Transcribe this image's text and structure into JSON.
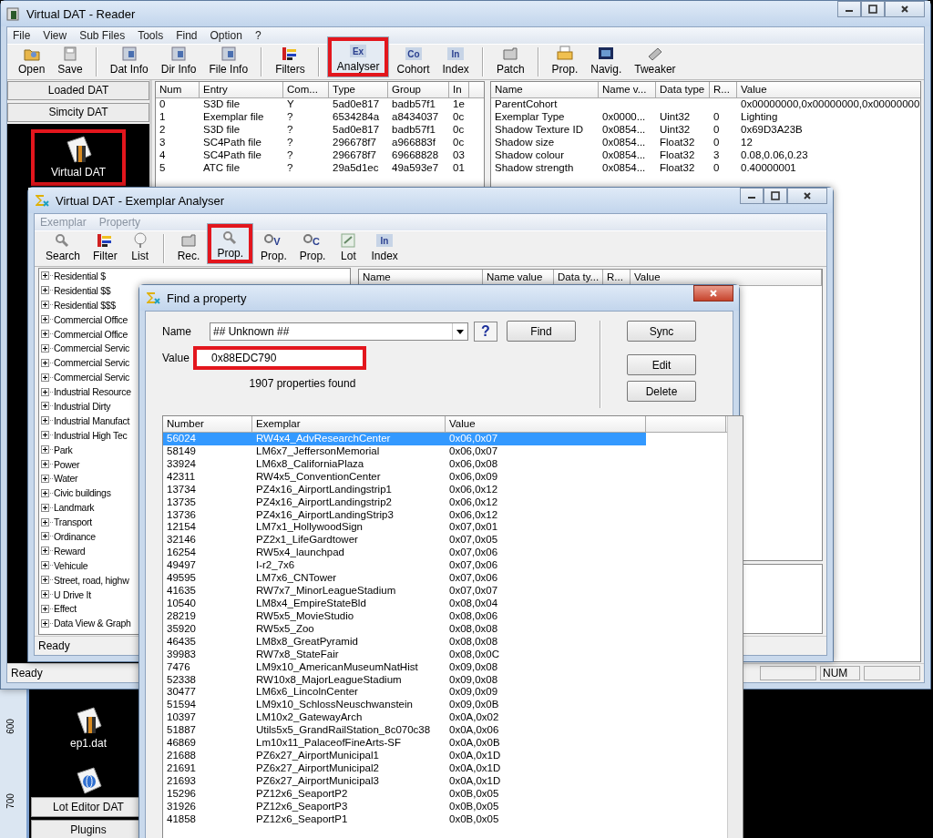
{
  "desktop": {
    "ruler_labels": [
      "600",
      "700"
    ],
    "icons": [
      {
        "label": "ep1.dat",
        "kind": "file"
      },
      {
        "kind": "globe"
      }
    ],
    "bars": [
      "Lot Editor DAT",
      "Plugins"
    ]
  },
  "main_window": {
    "title": "Virtual DAT - Reader",
    "menu": [
      "File",
      "View",
      "Sub Files",
      "Tools",
      "Find",
      "Option",
      "?"
    ],
    "toolbar": [
      {
        "kind": "folder",
        "label": "Open",
        "pressed": false,
        "highlighted": false
      },
      {
        "kind": "disk",
        "label": "Save",
        "pressed": false,
        "highlighted": false
      },
      {
        "kind": "separator"
      },
      {
        "kind": "info",
        "label": "Dat Info",
        "pressed": false,
        "highlighted": false
      },
      {
        "kind": "info",
        "label": "Dir Info",
        "pressed": false,
        "highlighted": false
      },
      {
        "kind": "info",
        "label": "File Info",
        "pressed": false,
        "highlighted": false
      },
      {
        "kind": "separator"
      },
      {
        "kind": "filter",
        "label": "Filters",
        "pressed": false,
        "highlighted": false
      },
      {
        "kind": "separator"
      },
      {
        "kind": "letters",
        "icon_text": "Ex",
        "label": "Analyser",
        "pressed": true,
        "highlighted": true
      },
      {
        "kind": "letters",
        "icon_text": "Co",
        "label": "Cohort",
        "pressed": false,
        "highlighted": false
      },
      {
        "kind": "letters",
        "icon_text": "In",
        "label": "Index",
        "pressed": false,
        "highlighted": false
      },
      {
        "kind": "separator"
      },
      {
        "kind": "patch",
        "label": "Patch",
        "pressed": false,
        "highlighted": false
      },
      {
        "kind": "separator"
      },
      {
        "kind": "printer",
        "label": "Prop.",
        "pressed": false,
        "highlighted": false
      },
      {
        "kind": "navig",
        "label": "Navig.",
        "pressed": false,
        "highlighted": false
      },
      {
        "kind": "tweaker",
        "label": "Tweaker",
        "pressed": false,
        "highlighted": false
      }
    ],
    "sidebar": {
      "tabs": [
        "Loaded DAT",
        "Simcity DAT"
      ],
      "items": [
        {
          "label": "Virtual DAT",
          "highlighted": true
        }
      ]
    },
    "entries_table": {
      "columns": [
        "Num",
        "Entry",
        "Com...",
        "Type",
        "Group",
        "In"
      ],
      "rows": [
        [
          "0",
          "S3D file",
          "Y",
          "5ad0e817",
          "badb57f1",
          "1e"
        ],
        [
          "1",
          "Exemplar file",
          "?",
          "6534284a",
          "a8434037",
          "0c"
        ],
        [
          "2",
          "S3D file",
          "?",
          "5ad0e817",
          "badb57f1",
          "0c"
        ],
        [
          "3",
          "SC4Path file",
          "?",
          "296678f7",
          "a966883f",
          "0c"
        ],
        [
          "4",
          "SC4Path file",
          "?",
          "296678f7",
          "69668828",
          "03"
        ],
        [
          "5",
          "ATC file",
          "?",
          "29a5d1ec",
          "49a593e7",
          "01"
        ]
      ]
    },
    "properties_table": {
      "columns": [
        "Name",
        "Name v...",
        "Data type",
        "R...",
        "Value"
      ],
      "rows": [
        [
          "ParentCohort",
          "",
          "",
          "",
          "0x00000000,0x00000000,0x00000000"
        ],
        [
          "Exemplar Type",
          "0x0000...",
          "Uint32",
          "0",
          "Lighting"
        ],
        [
          "Shadow Texture ID",
          "0x0854...",
          "Uint32",
          "0",
          "0x69D3A23B"
        ],
        [
          "Shadow size",
          "0x0854...",
          "Float32",
          "0",
          "12"
        ],
        [
          "Shadow colour",
          "0x0854...",
          "Float32",
          "3",
          "0.08,0.06,0.23"
        ],
        [
          "Shadow strength",
          "0x0854...",
          "Float32",
          "0",
          "0.40000001"
        ]
      ]
    },
    "status_bar": {
      "text": "Ready",
      "indicator": "NUM"
    }
  },
  "analyser_window": {
    "title": "Virtual DAT - Exemplar Analyser",
    "menu": [
      "Exemplar",
      "Property"
    ],
    "toolbar": [
      {
        "kind": "magnifier",
        "label": "Search",
        "pressed": false,
        "highlighted": false
      },
      {
        "kind": "filter",
        "label": "Filter",
        "pressed": false,
        "highlighted": false
      },
      {
        "kind": "tree",
        "label": "List",
        "pressed": false,
        "highlighted": false
      },
      {
        "kind": "separator"
      },
      {
        "kind": "patch",
        "label": "Rec.",
        "pressed": false,
        "highlighted": false
      },
      {
        "kind": "magnifier",
        "label": "Prop.",
        "pressed": true,
        "highlighted": true
      },
      {
        "kind": "magletter",
        "icon_text": "V",
        "label": "Prop.",
        "pressed": false,
        "highlighted": false
      },
      {
        "kind": "magletter",
        "icon_text": "C",
        "label": "Prop.",
        "pressed": false,
        "highlighted": false
      },
      {
        "kind": "lot",
        "label": "Lot",
        "pressed": false,
        "highlighted": false
      },
      {
        "kind": "letters",
        "icon_text": "In",
        "label": "Index",
        "pressed": false,
        "highlighted": false
      }
    ],
    "tree": [
      {
        "label": "Residential $",
        "expanded": false
      },
      {
        "label": "Residential $$",
        "expanded": false
      },
      {
        "label": "Residential $$$",
        "expanded": false
      },
      {
        "label": "Commercial Office",
        "expanded": false
      },
      {
        "label": "Commercial Office",
        "expanded": false
      },
      {
        "label": "Commercial Servic",
        "expanded": false
      },
      {
        "label": "Commercial Servic",
        "expanded": false
      },
      {
        "label": "Commercial Servic",
        "expanded": false
      },
      {
        "label": "Industrial Resource",
        "expanded": false
      },
      {
        "label": "Industrial Dirty",
        "expanded": false
      },
      {
        "label": "Industrial Manufact",
        "expanded": false
      },
      {
        "label": "Industrial High Tec",
        "expanded": false
      },
      {
        "label": "Park",
        "expanded": false
      },
      {
        "label": "Power",
        "expanded": false
      },
      {
        "label": "Water",
        "expanded": false
      },
      {
        "label": "Civic buildings",
        "expanded": false
      },
      {
        "label": "Landmark",
        "expanded": false
      },
      {
        "label": "Transport",
        "expanded": false
      },
      {
        "label": "Ordinance",
        "expanded": false
      },
      {
        "label": "Reward",
        "expanded": false
      },
      {
        "label": "Vehicule",
        "expanded": false
      },
      {
        "label": "Street, road, highw",
        "expanded": false
      },
      {
        "label": "U Drive It",
        "expanded": false
      },
      {
        "label": "Effect",
        "expanded": false
      },
      {
        "label": "Data View & Graph",
        "expanded": false
      }
    ],
    "properties_columns": [
      "Name",
      "Name value",
      "Data ty...",
      "R...",
      "Value"
    ],
    "status_bar": "Ready"
  },
  "find_dialog": {
    "title": "Find a property",
    "name_label": "Name",
    "name_value": "## Unknown ##",
    "help_button": "?",
    "find_button": "Find",
    "side_buttons": [
      "Sync",
      "Edit",
      "Delete"
    ],
    "value_label": "Value",
    "value": "0x88EDC790",
    "value_highlighted": true,
    "result_text": "1907 properties found",
    "columns": [
      "Number",
      "Exemplar",
      "Value"
    ],
    "rows": [
      {
        "cells": [
          "56024",
          "RW4x4_AdvResearchCenter",
          "0x06,0x07"
        ],
        "selected": true
      },
      {
        "cells": [
          "58149",
          "LM6x7_JeffersonMemorial",
          "0x06,0x07"
        ],
        "selected": false
      },
      {
        "cells": [
          "33924",
          "LM6x8_CaliforniaPlaza",
          "0x06,0x08"
        ],
        "selected": false
      },
      {
        "cells": [
          "42311",
          "RW4x5_ConventionCenter",
          "0x06,0x09"
        ],
        "selected": false
      },
      {
        "cells": [
          "13734",
          "PZ4x16_AirportLandingstrip1",
          "0x06,0x12"
        ],
        "selected": false
      },
      {
        "cells": [
          "13735",
          "PZ4x16_AirportLandingstrip2",
          "0x06,0x12"
        ],
        "selected": false
      },
      {
        "cells": [
          "13736",
          "PZ4x16_AirportLandingStrip3",
          "0x06,0x12"
        ],
        "selected": false
      },
      {
        "cells": [
          "12154",
          "LM7x1_HollywoodSign",
          "0x07,0x01"
        ],
        "selected": false
      },
      {
        "cells": [
          "32146",
          "PZ2x1_LifeGardtower",
          "0x07,0x05"
        ],
        "selected": false
      },
      {
        "cells": [
          "16254",
          "RW5x4_launchpad",
          "0x07,0x06"
        ],
        "selected": false
      },
      {
        "cells": [
          "49497",
          "I-r2_7x6",
          "0x07,0x06"
        ],
        "selected": false
      },
      {
        "cells": [
          "49595",
          "LM7x6_CNTower",
          "0x07,0x06"
        ],
        "selected": false
      },
      {
        "cells": [
          "41635",
          "RW7x7_MinorLeagueStadium",
          "0x07,0x07"
        ],
        "selected": false
      },
      {
        "cells": [
          "10540",
          "LM8x4_EmpireStateBld",
          "0x08,0x04"
        ],
        "selected": false
      },
      {
        "cells": [
          "28219",
          "RW5x5_MovieStudio",
          "0x08,0x06"
        ],
        "selected": false
      },
      {
        "cells": [
          "35920",
          "RW5x5_Zoo",
          "0x08,0x08"
        ],
        "selected": false
      },
      {
        "cells": [
          "46435",
          "LM8x8_GreatPyramid",
          "0x08,0x08"
        ],
        "selected": false
      },
      {
        "cells": [
          "39983",
          "RW7x8_StateFair",
          "0x08,0x0C"
        ],
        "selected": false
      },
      {
        "cells": [
          "7476",
          "LM9x10_AmericanMuseumNatHist",
          "0x09,0x08"
        ],
        "selected": false
      },
      {
        "cells": [
          "52338",
          "RW10x8_MajorLeagueStadium",
          "0x09,0x08"
        ],
        "selected": false
      },
      {
        "cells": [
          "30477",
          "LM6x6_LincolnCenter",
          "0x09,0x09"
        ],
        "selected": false
      },
      {
        "cells": [
          "51594",
          "LM9x10_SchlossNeuschwanstein",
          "0x09,0x0B"
        ],
        "selected": false
      },
      {
        "cells": [
          "10397",
          "LM10x2_GatewayArch",
          "0x0A,0x02"
        ],
        "selected": false
      },
      {
        "cells": [
          "51887",
          "Utils5x5_GrandRailStation_8c070c38",
          "0x0A,0x06"
        ],
        "selected": false
      },
      {
        "cells": [
          "46869",
          "Lm10x11_PalaceofFineArts-SF",
          "0x0A,0x0B"
        ],
        "selected": false
      },
      {
        "cells": [
          "21688",
          "PZ6x27_AirportMunicipal1",
          "0x0A,0x1D"
        ],
        "selected": false
      },
      {
        "cells": [
          "21691",
          "PZ6x27_AirportMunicipal2",
          "0x0A,0x1D"
        ],
        "selected": false
      },
      {
        "cells": [
          "21693",
          "PZ6x27_AirportMunicipal3",
          "0x0A,0x1D"
        ],
        "selected": false
      },
      {
        "cells": [
          "15296",
          "PZ12x6_SeaportP2",
          "0x0B,0x05"
        ],
        "selected": false
      },
      {
        "cells": [
          "31926",
          "PZ12x6_SeaportP3",
          "0x0B,0x05"
        ],
        "selected": false
      },
      {
        "cells": [
          "41858",
          "PZ12x6_SeaportP1",
          "0x0B,0x05"
        ],
        "selected": false
      }
    ]
  }
}
